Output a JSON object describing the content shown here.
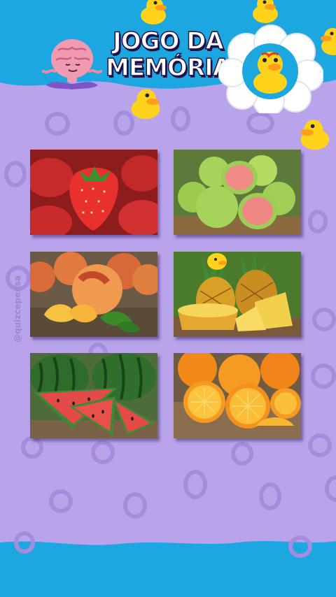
{
  "game": {
    "title_line1": "JOGO DA",
    "title_line2": "MEMÓRIA",
    "watermark": "@quizcepensa"
  },
  "cards": [
    {
      "fruit": "strawberry",
      "icon": "strawberry-card-icon"
    },
    {
      "fruit": "guava",
      "icon": "guava-card-icon"
    },
    {
      "fruit": "peach",
      "icon": "peach-card-icon"
    },
    {
      "fruit": "pineapple",
      "icon": "pineapple-card-icon"
    },
    {
      "fruit": "watermelon",
      "icon": "watermelon-card-icon"
    },
    {
      "fruit": "orange",
      "icon": "orange-card-icon"
    }
  ],
  "colors": {
    "sky_blue": "#1da7e0",
    "lavender": "#b9a4ec",
    "ring": "#a58ddd",
    "title_outline": "#21104a"
  }
}
